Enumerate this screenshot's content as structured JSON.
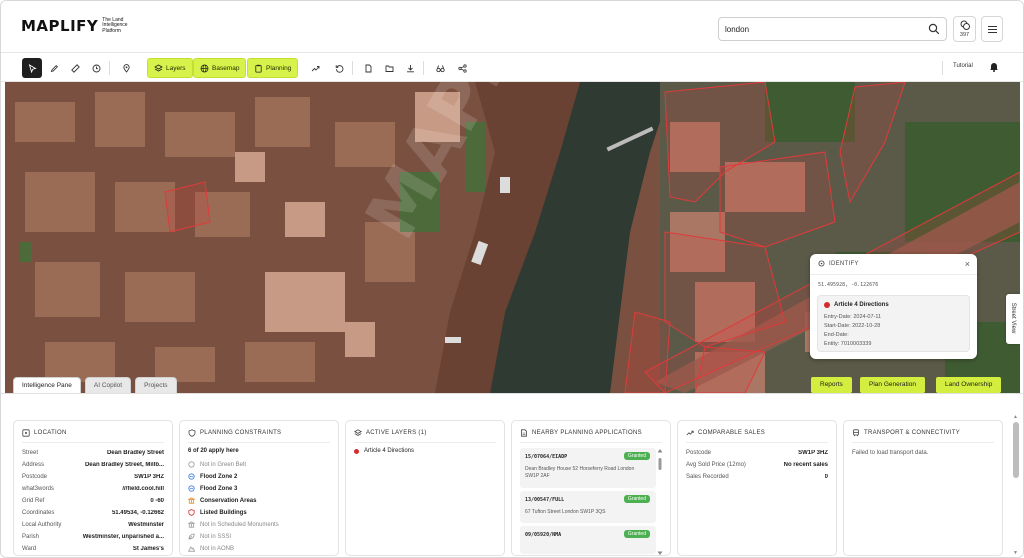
{
  "header": {
    "logo": "MAPLIFY",
    "tagline": "The Land Intelligence Platform",
    "search_value": "london",
    "credits": "397"
  },
  "toolbar": {
    "layers_label": "Layers",
    "basemap_label": "Basemap",
    "planning_label": "Planning",
    "tutorial_label": "Tutorial"
  },
  "map": {
    "watermark": "MAPLIFY",
    "street_view_label": "Street View",
    "tabs": [
      "Intelligence Pane",
      "AI Copilot",
      "Projects"
    ],
    "actions": [
      "Reports",
      "Plan Generation",
      "Land Ownership"
    ]
  },
  "identify": {
    "title": "IDENTIFY",
    "coords": "51.495928, -0.122676",
    "feature_title": "Article 4 Directions",
    "entry_date": "Entry-Date: 2024-07-11",
    "start_date": "Start-Date: 2022-10-28",
    "end_date": "End-Date:",
    "entity": "Entity: 7010003339"
  },
  "location": {
    "title": "LOCATION",
    "rows": [
      {
        "k": "Street",
        "v": "Dean Bradley Street"
      },
      {
        "k": "Address",
        "v": "Dean Bradley Street, Millb..."
      },
      {
        "k": "Postcode",
        "v": "SW1P 3HZ"
      },
      {
        "k": "what3words",
        "v": "///field.cool.hill"
      },
      {
        "k": "Grid Ref",
        "v": "0 -60"
      },
      {
        "k": "Coordinates",
        "v": "51.49534, -0.12662"
      },
      {
        "k": "Local Authority",
        "v": "Westminster"
      },
      {
        "k": "Parish",
        "v": "Westminster, unparished a..."
      },
      {
        "k": "Ward",
        "v": "St James's"
      }
    ]
  },
  "planning_constraints": {
    "title": "PLANNING CONSTRAINTS",
    "summary": "6 of 20 apply here",
    "items": [
      {
        "label": "Not in Green Belt",
        "active": false
      },
      {
        "label": "Flood Zone 2",
        "active": true
      },
      {
        "label": "Flood Zone 3",
        "active": true
      },
      {
        "label": "Conservation Areas",
        "active": true
      },
      {
        "label": "Listed Buildings",
        "active": true
      },
      {
        "label": "Not in Scheduled Monuments",
        "active": false
      },
      {
        "label": "Not in SSSI",
        "active": false
      },
      {
        "label": "Not in AONB",
        "active": false
      }
    ]
  },
  "active_layers": {
    "title": "ACTIVE LAYERS (1)",
    "items": [
      "Article 4 Directions"
    ]
  },
  "nearby_applications": {
    "title": "NEARBY PLANNING APPLICATIONS",
    "items": [
      {
        "ref": "15/07064/EIADP",
        "status": "Granted",
        "address": "Dean Bradley House 52 Horseferry Road London SW1P 2AF"
      },
      {
        "ref": "13/00547/FULL",
        "status": "Granted",
        "address": "67 Tufton Street London SW1P 3QS"
      },
      {
        "ref": "09/05920/NMA",
        "status": "Granted",
        "address": ""
      }
    ]
  },
  "comparable_sales": {
    "title": "COMPARABLE SALES",
    "rows": [
      {
        "k": "Postcode",
        "v": "SW1P 3HZ"
      },
      {
        "k": "Avg Sold Price (12mo)",
        "v": "No recent sales"
      },
      {
        "k": "Sales Recorded",
        "v": "0"
      }
    ]
  },
  "transport": {
    "title": "TRANSPORT & CONNECTIVITY",
    "message": "Failed to load transport data."
  }
}
